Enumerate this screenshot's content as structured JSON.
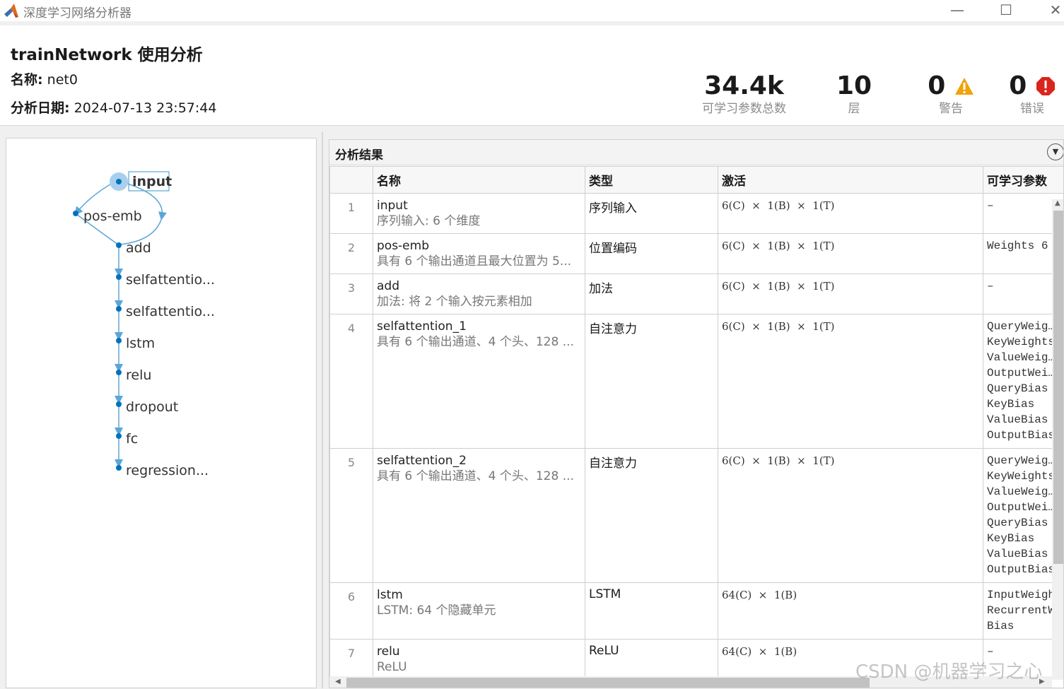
{
  "window": {
    "title": "深度学习网络分析器",
    "minimize": "—",
    "maximize": "☐",
    "close": "✕"
  },
  "header": {
    "title": "trainNetwork 使用分析",
    "name_label": "名称:",
    "name_value": "net0",
    "date_label": "分析日期:",
    "date_value": "2024-07-13 23:57:44"
  },
  "stats": {
    "params": {
      "value": "34.4k",
      "label": "可学习参数总数"
    },
    "layers": {
      "value": "10",
      "label": "层"
    },
    "warnings": {
      "value": "0",
      "label": "警告"
    },
    "errors": {
      "value": "0",
      "label": "错误"
    }
  },
  "graph": {
    "nodes": [
      "input",
      "pos-emb",
      "add",
      "selfattentio...",
      "selfattentio...",
      "lstm",
      "relu",
      "dropout",
      "fc",
      "regression..."
    ],
    "selected": "input"
  },
  "results": {
    "title": "分析结果",
    "columns": {
      "name": "名称",
      "type": "类型",
      "activation": "激活",
      "params": "可学习参数"
    },
    "rows": [
      {
        "idx": "1",
        "name": "input",
        "desc": "序列输入: 6 个维度",
        "type": "序列输入",
        "act": "6(C)  ×  1(B)  ×  1(T)",
        "params": [
          "–"
        ]
      },
      {
        "idx": "2",
        "name": "pos-emb",
        "desc": "具有 6 个输出通道且最大位置为 5...",
        "type": "位置编码",
        "act": "6(C)  ×  1(B)  ×  1(T)",
        "params": [
          "Weights  6"
        ]
      },
      {
        "idx": "3",
        "name": "add",
        "desc": "加法: 将 2 个输入按元素相加",
        "type": "加法",
        "act": "6(C)  ×  1(B)  ×  1(T)",
        "params": [
          "–"
        ]
      },
      {
        "idx": "4",
        "name": "selfattention_1",
        "desc": "具有 6 个输出通道、4 个头、128 ...",
        "type": "自注意力",
        "act": "6(C)  ×  1(B)  ×  1(T)",
        "params": [
          "QueryWeig…",
          "KeyWeights",
          "ValueWeig…",
          "OutputWei…",
          "QueryBias",
          "KeyBias",
          "ValueBias",
          "OutputBias"
        ]
      },
      {
        "idx": "5",
        "name": "selfattention_2",
        "desc": "具有 6 个输出通道、4 个头、128 ...",
        "type": "自注意力",
        "act": "6(C)  ×  1(B)  ×  1(T)",
        "params": [
          "QueryWeig…",
          "KeyWeights",
          "ValueWeig…",
          "OutputWei…",
          "QueryBias",
          "KeyBias",
          "ValueBias",
          "OutputBias"
        ]
      },
      {
        "idx": "6",
        "name": "lstm",
        "desc": "LSTM: 64 个隐藏单元",
        "type": "LSTM",
        "act": "64(C)  ×  1(B)",
        "params": [
          "InputWeigh",
          "RecurrentW",
          "Bias"
        ]
      },
      {
        "idx": "7",
        "name": "relu",
        "desc": "ReLU",
        "type": "ReLU",
        "act": "64(C)  ×  1(B)",
        "params": [
          "–"
        ]
      }
    ]
  },
  "watermark": "CSDN @机器学习之心",
  "colors": {
    "accent": "#0072bd",
    "edge": "#5aa6d6",
    "warning": "#f0a30a",
    "error": "#d9251c"
  }
}
